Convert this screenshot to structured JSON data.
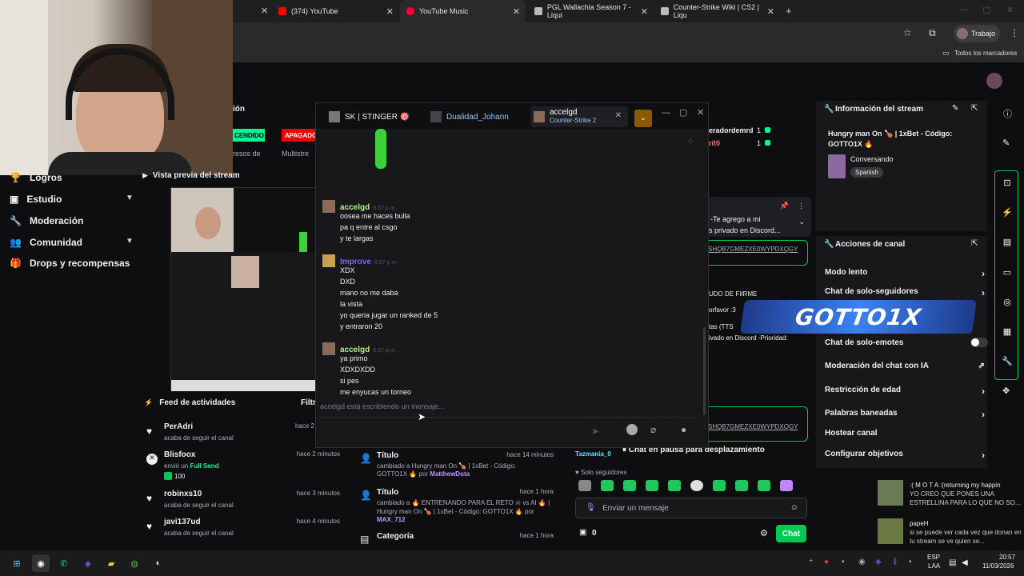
{
  "browser": {
    "tabs": [
      {
        "label": "(374) YouTube",
        "color": "#ff0000"
      },
      {
        "label": "YouTube Music",
        "color": "#ff0033"
      },
      {
        "label": "PGL Wallachia Season 7 - Liqui",
        "color": "#bbbbbb"
      },
      {
        "label": "Counter-Strike Wiki | CS2 | Liqu",
        "color": "#bbbbbb"
      }
    ],
    "profile_label": "Trabajo",
    "bookmarks_label": "Todos los marcadores"
  },
  "sidebar": {
    "items": [
      {
        "label": "Logros",
        "icon": "trophy-icon"
      },
      {
        "label": "Estudio",
        "icon": "video-icon",
        "chevron": true
      },
      {
        "label": "Moderación",
        "icon": "wrench-icon"
      },
      {
        "label": "Comunidad",
        "icon": "people-icon",
        "chevron": true
      },
      {
        "label": "Drops y recompensas",
        "icon": "gift-icon"
      }
    ]
  },
  "top_fragments": {
    "section_frag": "ión",
    "btn_encendido": "CENDIDO",
    "btn_apagado": "APAGADO",
    "tab_recursos": "resos de",
    "tab_multistream": "Multistre"
  },
  "preview": {
    "title": "Vista previa del stream"
  },
  "feed": {
    "title": "Feed de actividades",
    "filter": "Filtr",
    "items": [
      {
        "name": "PerAdri",
        "sub": "acaba de seguir el canal",
        "time": "hace 2",
        "icon": "heart-icon"
      },
      {
        "name": "Blisfoox",
        "sub": "envió un",
        "extra": "Full Send",
        "amount": "100",
        "time": "hace 2 minutos",
        "icon": "bits-icon"
      },
      {
        "name": "robinxs10",
        "sub": "acaba de seguir el canal",
        "time": "hace 3 minutos",
        "icon": "heart-icon"
      },
      {
        "name": "javi137ud",
        "sub": "acaba de seguir el canal",
        "time": "hace 4 minutos",
        "icon": "heart-icon"
      }
    ]
  },
  "stream_changes": {
    "items": [
      {
        "title": "Título",
        "time": "hace 14 minutos",
        "line1": "cambiado a Hungry man On 🍗 | 1xBet - Código:",
        "line2": "GOTTO1X 🔥 por",
        "user": "MatthewDota"
      },
      {
        "title": "Título",
        "time": "hace 1 hora",
        "line1": "cambiado a 🔥 ENTRENANDO PARA EL RETO ☠ vs AI 🔥 |",
        "line2": "Hungry man On 🍗 | 1xBet - Código: GOTTO1X 🔥 por",
        "user": "MAX_712"
      },
      {
        "title": "Categoría",
        "time": "hace 1 hora"
      }
    ]
  },
  "mod_list": {
    "users": [
      {
        "name": "eradordemrd",
        "count": "1"
      },
      {
        "name": "rit0",
        "count": "1"
      }
    ],
    "pinned_line1": "-Te agrego a mi",
    "pinned_line2": "s privado en Discord...",
    "link1": "SHQB7GMEZXE0WYPDXQGY",
    "text_a": "UDO DE FIIRME",
    "text_b": "orfavor :3",
    "text_c": "tas (TTS",
    "text_d": "ivado en Discord -Prioridad:",
    "link2": "SHQB7GMEZXE0WYPDXQGY",
    "pause_user": "Tazmania_0",
    "pause_text": "Chat en pausa para desplazamiento",
    "followers_only": "Solo seguidores",
    "input_placeholder": "Enviar un mensaje",
    "points": "0",
    "chat_button": "Chat"
  },
  "stream_info": {
    "title": "Información del stream",
    "stream_title": "Hungry man On 🍗 | 1xBet - Código: GOTTO1X 🔥",
    "category": "Conversando",
    "language": "Spanish"
  },
  "channel_actions": {
    "title": "Acciones de canal",
    "items": [
      {
        "label": "Modo lento",
        "type": "arrow"
      },
      {
        "label": "Chat de solo-seguidores",
        "type": "arrow"
      },
      {
        "label": "Chat de solo-emotes",
        "type": "toggle"
      },
      {
        "label": "Moderación del chat con IA",
        "type": "external"
      },
      {
        "label": "Restricción de edad",
        "type": "arrow"
      },
      {
        "label": "Palabras baneadas",
        "type": "arrow"
      },
      {
        "label": "Hostear canal",
        "type": "none"
      },
      {
        "label": "Configurar objetivos",
        "type": "arrow"
      }
    ],
    "banner": "GOTTO1X"
  },
  "chat_window": {
    "tabs": [
      {
        "label": "SK | STINGER 🎯"
      },
      {
        "label": "Dualidad_Johann"
      },
      {
        "label": "accelgd",
        "sub": "Counter-Strike 2"
      }
    ],
    "messages": [
      {
        "user": "accelgd",
        "color": "#b4f28a",
        "time": "8:57 p.m.",
        "lines": [
          "oosea me haces bulla",
          "pa q entre al csgo",
          "y te largas"
        ]
      },
      {
        "user": "Improve",
        "color": "#7b68ee",
        "time": "8:57 p.m.",
        "lines": [
          "XDX",
          "DXD",
          "mano no me daba",
          "la vista",
          "yo queria jugar un ranked de 5",
          "y entraron 20"
        ]
      },
      {
        "user": "accelgd",
        "color": "#b4f28a",
        "time": "8:57 p.m.",
        "lines": [
          "ya primo",
          "XDXDXDD",
          "si pes",
          "me enyucas un torneo"
        ]
      }
    ],
    "typing": "accelgd está escribiendo un mensaje..."
  },
  "float_chat": [
    {
      "user": ":( M O T A :(returning my happin",
      "text": "YO CREO QUE PONES UNA ESTRELLINA PARA LO QUE NO SO..."
    },
    {
      "user": "papeH",
      "text": "si se puede ver cada vez que donan en tu stream se ve quien se..."
    }
  ],
  "taskbar": {
    "lang1": "ESP",
    "lang2": "LAA",
    "time": "20:57",
    "date": "11/03/2026"
  }
}
